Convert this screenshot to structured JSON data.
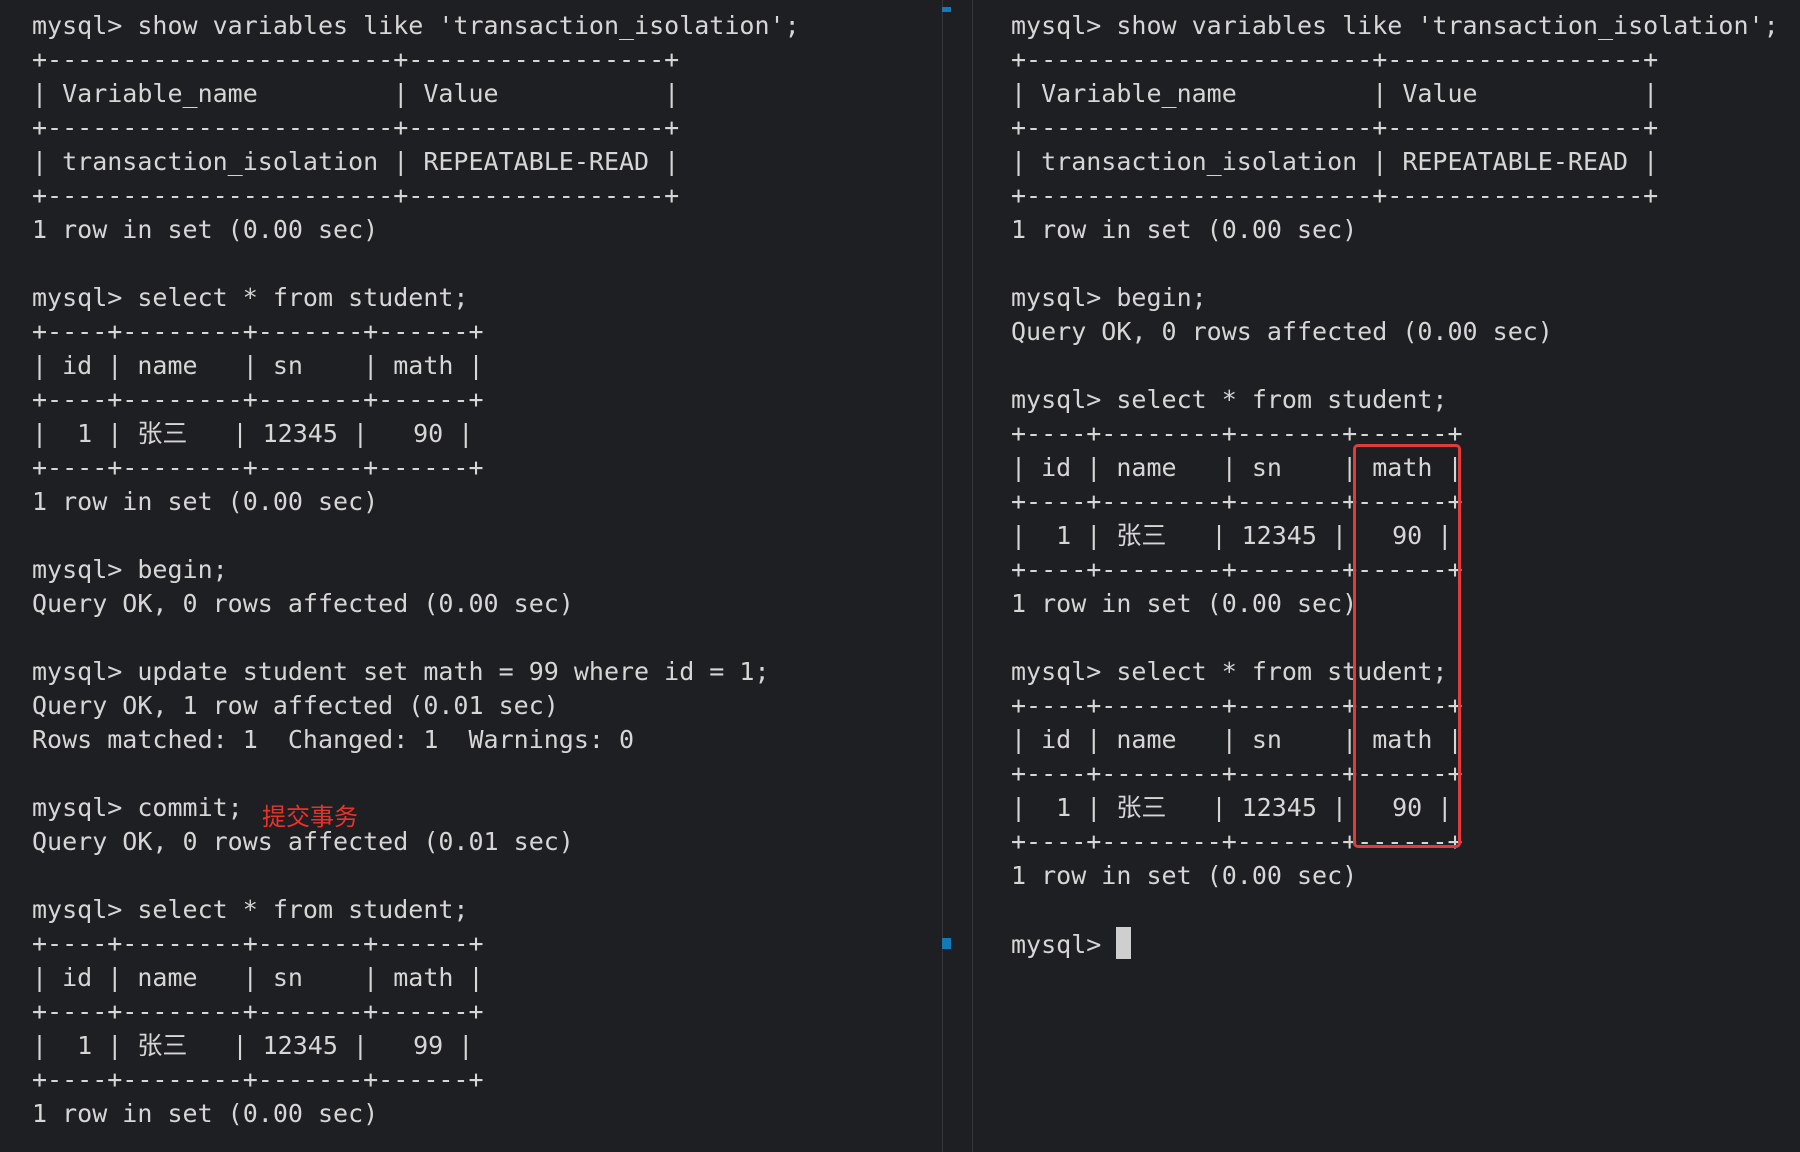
{
  "left_terminal": {
    "lines": [
      "mysql> show variables like 'transaction_isolation';",
      "+-----------------------+-----------------+",
      "| Variable_name         | Value           |",
      "+-----------------------+-----------------+",
      "| transaction_isolation | REPEATABLE-READ |",
      "+-----------------------+-----------------+",
      "1 row in set (0.00 sec)",
      "",
      "mysql> select * from student;",
      "+----+--------+-------+------+",
      "| id | name   | sn    | math |",
      "+----+--------+-------+------+",
      "|  1 | 张三   | 12345 |   90 |",
      "+----+--------+-------+------+",
      "1 row in set (0.00 sec)",
      "",
      "mysql> begin;",
      "Query OK, 0 rows affected (0.00 sec)",
      "",
      "mysql> update student set math = 99 where id = 1;",
      "Query OK, 1 row affected (0.01 sec)",
      "Rows matched: 1  Changed: 1  Warnings: 0",
      "",
      "mysql> commit;",
      "Query OK, 0 rows affected (0.01 sec)",
      "",
      "mysql> select * from student;",
      "+----+--------+-------+------+",
      "| id | name   | sn    | math |",
      "+----+--------+-------+------+",
      "|  1 | 张三   | 12345 |   99 |",
      "+----+--------+-------+------+",
      "1 row in set (0.00 sec)"
    ],
    "annotation": "提交事务"
  },
  "right_terminal": {
    "lines": [
      "mysql> show variables like 'transaction_isolation';",
      "+-----------------------+-----------------+",
      "| Variable_name         | Value           |",
      "+-----------------------+-----------------+",
      "| transaction_isolation | REPEATABLE-READ |",
      "+-----------------------+-----------------+",
      "1 row in set (0.00 sec)",
      "",
      "mysql> begin;",
      "Query OK, 0 rows affected (0.00 sec)",
      "",
      "mysql> select * from student;",
      "+----+--------+-------+------+",
      "| id | name   | sn    | math |",
      "+----+--------+-------+------+",
      "|  1 | 张三   | 12345 |   90 |",
      "+----+--------+-------+------+",
      "1 row in set (0.00 sec)",
      "",
      "mysql> select * from student;",
      "+----+--------+-------+------+",
      "| id | name   | sn    | math |",
      "+----+--------+-------+------+",
      "|  1 | 张三   | 12345 |   90 |",
      "+----+--------+-------+------+",
      "1 row in set (0.00 sec)",
      ""
    ],
    "prompt": "mysql> "
  },
  "colors": {
    "background": "#1e1f23",
    "text": "#d6d6d6",
    "annotation": "#e8332b",
    "highlight": "#e23b3b",
    "scroll_marker": "#1479b8"
  }
}
